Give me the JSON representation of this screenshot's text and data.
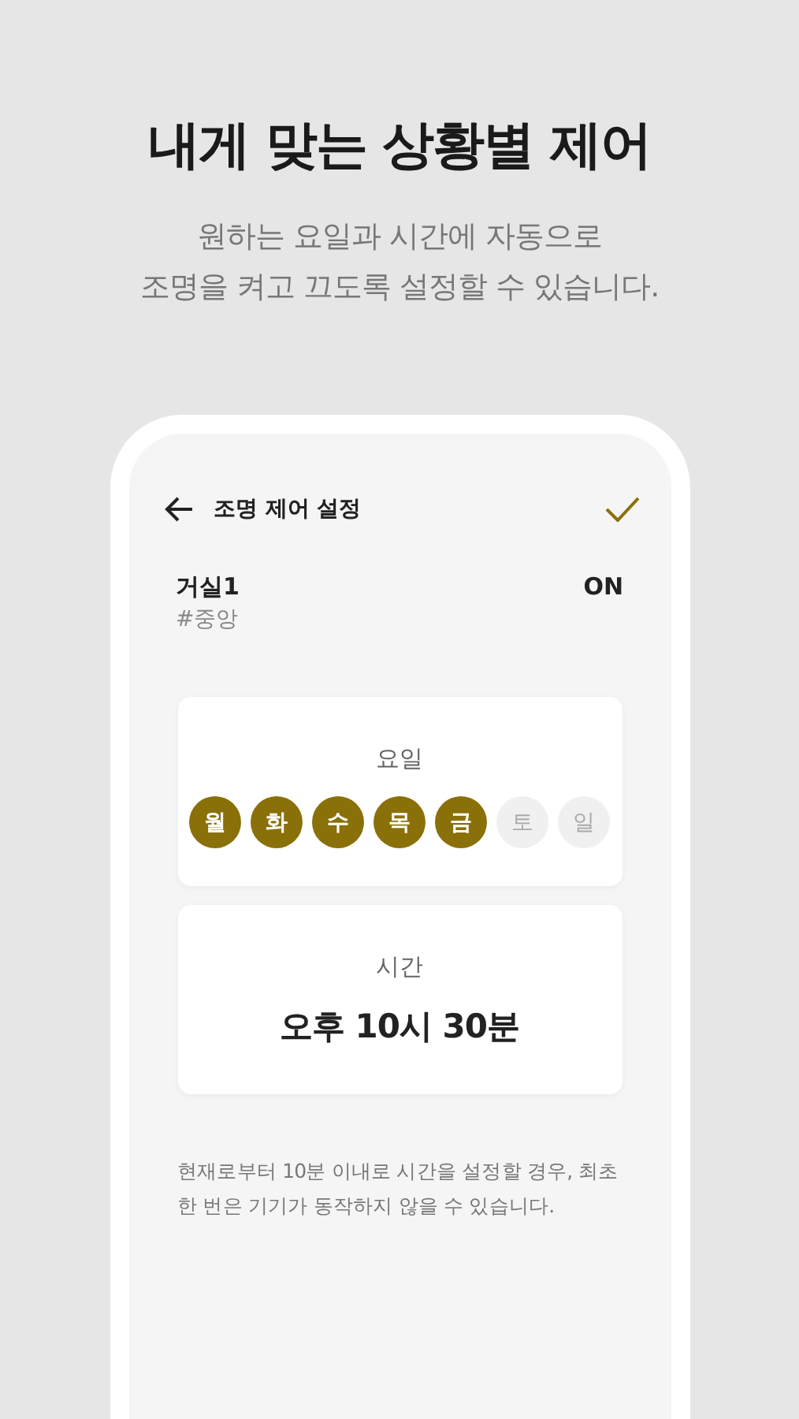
{
  "headline": "내게 맞는 상황별 제어",
  "subtitle_lines": [
    "원하는 요일과 시간에 자동으로",
    "조명을 켜고 끄도록 설정할 수 있습니다."
  ],
  "screen": {
    "title": "조명 제어 설정",
    "device": {
      "name": "거실1",
      "tag": "#중앙",
      "status": "ON"
    },
    "days_card": {
      "label": "요일",
      "days": [
        {
          "label": "월",
          "selected": true
        },
        {
          "label": "화",
          "selected": true
        },
        {
          "label": "수",
          "selected": true
        },
        {
          "label": "목",
          "selected": true
        },
        {
          "label": "금",
          "selected": true
        },
        {
          "label": "토",
          "selected": false
        },
        {
          "label": "일",
          "selected": false
        }
      ]
    },
    "time_card": {
      "label": "시간",
      "value": "오후 10시 30분"
    },
    "note": "현재로부터 10분 이내로 시간을 설정할 경우, 최초 한 번은 기기가 동작하지 않을 수 있습니다."
  }
}
